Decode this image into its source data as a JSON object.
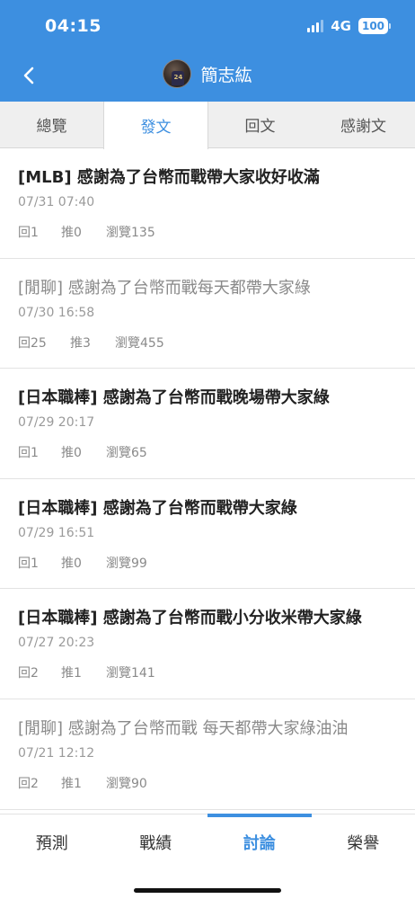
{
  "status_bar": {
    "time": "04:15",
    "network": "4G",
    "battery": "100"
  },
  "header": {
    "title": "簡志紘",
    "avatar_text": "24"
  },
  "tabs": [
    {
      "label": "總覽"
    },
    {
      "label": "發文"
    },
    {
      "label": "回文"
    },
    {
      "label": "感謝文"
    }
  ],
  "posts": [
    {
      "title": "[MLB] 感謝為了台幣而戰帶大家收好收滿",
      "date": "07/31 07:40",
      "reply": "回1",
      "push": "推0",
      "views": "瀏覽135"
    },
    {
      "title": "[閒聊] 感謝為了台幣而戰每天都帶大家綠",
      "date": "07/30 16:58",
      "reply": "回25",
      "push": "推3",
      "views": "瀏覽455"
    },
    {
      "title": "[日本職棒] 感謝為了台幣而戰晚場帶大家綠",
      "date": "07/29 20:17",
      "reply": "回1",
      "push": "推0",
      "views": "瀏覽65"
    },
    {
      "title": "[日本職棒] 感謝為了台幣而戰帶大家綠",
      "date": "07/29 16:51",
      "reply": "回1",
      "push": "推0",
      "views": "瀏覽99"
    },
    {
      "title": "[日本職棒] 感謝為了台幣而戰小分收米帶大家綠",
      "date": "07/27 20:23",
      "reply": "回2",
      "push": "推1",
      "views": "瀏覽141"
    },
    {
      "title": "[閒聊] 感謝為了台幣而戰 每天都帶大家綠油油",
      "date": "07/21 12:12",
      "reply": "回2",
      "push": "推1",
      "views": "瀏覽90"
    }
  ],
  "bottom_nav": [
    {
      "label": "預測"
    },
    {
      "label": "戰績"
    },
    {
      "label": "討論"
    },
    {
      "label": "榮譽"
    }
  ],
  "colors": {
    "accent": "#3d8fe0"
  }
}
